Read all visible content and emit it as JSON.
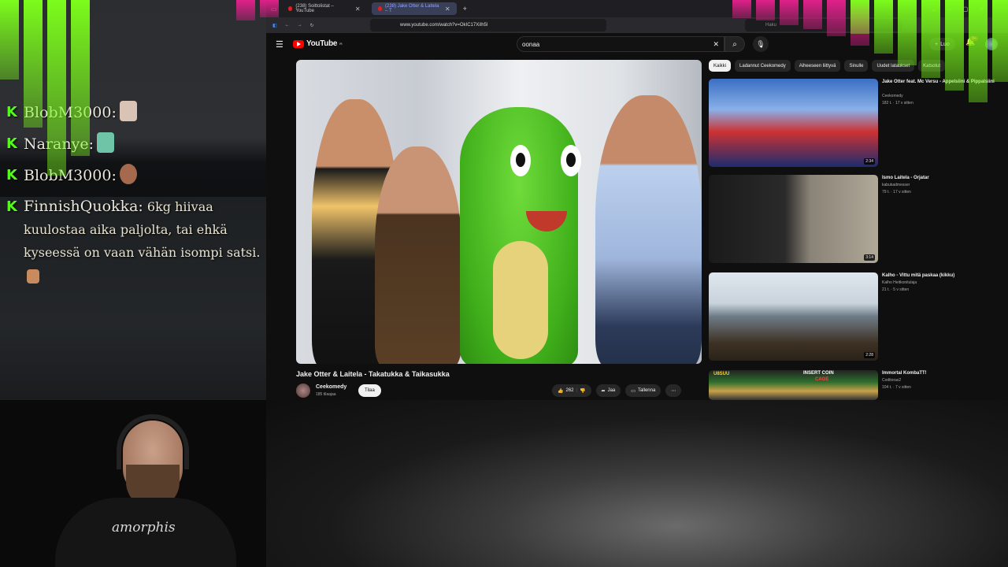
{
  "chat": {
    "messages": [
      {
        "user": "BlobM3000:",
        "text": "",
        "emote_color": "#d9c3b5"
      },
      {
        "user": "Naranye:",
        "text": "",
        "emote_color": "#6fc4a8"
      },
      {
        "user": "BlobM3000:",
        "text": "",
        "emote_color": "#a56a4e"
      },
      {
        "user": "FinnishQuokka:",
        "text": "6kg hiivaa kuulostaa aika paljolta, tai ehkä kyseessä on vaan vähän isompi satsi.",
        "emote_color": "#c98a5d"
      }
    ],
    "badge": "K"
  },
  "browser": {
    "tabs": [
      {
        "label": "(238) Soittolistat – YouTube",
        "active": false
      },
      {
        "label": "(238) Jake Otter & Laitela – T",
        "active": true
      }
    ],
    "url": "www.youtube.com/watch?v=OkIC17XiIh5I",
    "web_search_placeholder": "Haku"
  },
  "youtube": {
    "logo_text": "YouTube",
    "country_code": "FI",
    "search_value": "oonaa",
    "create_label": "Luo",
    "notifications_badge": "9+",
    "video": {
      "title": "Jake Otter & Laitela - Takatukka & Taikasukka",
      "channel": "Ceekomedy",
      "subscribers": "185 tilaajaa",
      "subscribe_label": "Tilaa",
      "likes": "262",
      "share_label": "Jaa",
      "save_label": "Tallenna"
    },
    "chips": [
      {
        "label": "Kaikki",
        "active": true
      },
      {
        "label": "Ladannut Ceekomedy",
        "active": false
      },
      {
        "label": "Aiheeseen liittyvä",
        "active": false
      },
      {
        "label": "Sinulle",
        "active": false
      },
      {
        "label": "Uudet lataukset",
        "active": false
      },
      {
        "label": "Katsotut",
        "active": false
      }
    ],
    "recommendations": [
      {
        "title": "Jake Otter feat. Mc Versu - Appelsiini & Pippalsiini",
        "channel": "Ceekomedy",
        "meta": "182 t. · 17 v sitten",
        "duration": "2:34"
      },
      {
        "title": "Ismo Laitela - Orjatar",
        "channel": "kabukadmesser",
        "meta": "79 t. · 17 v sitten",
        "duration": "3:14"
      },
      {
        "title": "Kalho - Vittu mitä paskaa (kikku)",
        "channel": "Kalho Heitkonitulaja",
        "meta": "21 t. · 5 v sitten",
        "duration": "2:28"
      },
      {
        "title": "Immortal KombaTT!",
        "channel": "Coditoras2",
        "meta": "104 t. · 7 v sitten",
        "duration": ""
      }
    ],
    "game_thumb_text": "INSERT COIN",
    "game_thumb_text2": "CAGE"
  },
  "streamer": {
    "shirt_text": "amorphis"
  },
  "colors": {
    "kick_green": "#53fc18",
    "yt_red": "#ff0000",
    "bar_green": "#7cfc1c",
    "bar_pink": "#e0208a"
  },
  "audio_bars": {
    "left_green": [
      0.28,
      0.45,
      0.62,
      0.55
    ],
    "left_pink": [
      0.12,
      0.1
    ],
    "right_pink": [
      0.08,
      0.09,
      0.11,
      0.13,
      0.16,
      0.2
    ],
    "right_green": [
      0.24,
      0.38,
      0.46,
      0.55,
      0.64,
      0.72,
      0.58
    ]
  }
}
